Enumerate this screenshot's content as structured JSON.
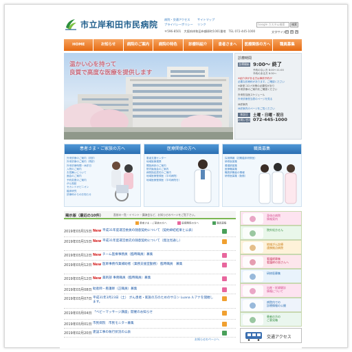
{
  "site": {
    "title": "市立岸和田市民病院"
  },
  "header": {
    "links": [
      "病院・交通アクセス",
      "サイトマップ",
      "プライバシーポリシー",
      "リンク"
    ],
    "address": "〒596-8501　大阪府岸和田市額原町1001番地　TEL 072-445-1000",
    "search_placeholder": "Google カスタム検索",
    "search_button": "検索",
    "fontsize_label": "文字サイズ",
    "fontsize_options": [
      "小",
      "中",
      "大"
    ]
  },
  "nav": [
    "HOME",
    "お知らせ",
    "病院のご案内",
    "病院の特色",
    "診療科紹介",
    "患者さまへ",
    "医療関係の方へ",
    "職員募集"
  ],
  "hero": {
    "slogan_line1": "温かい心を持って",
    "slogan_line2": "良質で高度な医療を提供します"
  },
  "hours": {
    "title": "診療時間",
    "reception_tag": "診療開始",
    "reception_time": "9:00～ 終了",
    "note1": "予約のない方 8:00～11:00",
    "note2": "予約のある方 8:30～",
    "note_red": "※紹介状がある方は事前予約が",
    "note_link": "必要な診療科があります。ご確認ください",
    "note_lines": [
      "※新型コロナ対策の必要性があり",
      "外来診療のご案内をご確認ください"
    ],
    "schedule_title": "外来担当医スケジュール",
    "schedule_link": "外来診療担当表のページを見る",
    "closed_title": "休診案内",
    "closed_link": "休診案内のページをご覧ください",
    "holiday_tag": "休診日",
    "holiday_text": "土曜・日曜・祝日",
    "tel_tag": "お問い合わせ",
    "tel": "072-445-1000",
    "info_button": "休診案内のページをご覧ください"
  },
  "categories": [
    {
      "title": "患者さま・ご家族の方へ",
      "links": [
        "外来診療のご案内（初診）",
        "外来診療のご案内（再診）",
        "外来診療時間・休診日",
        "入院のご案内",
        "お見舞いについて",
        "面会のご案内",
        "予約変更のご案内",
        "がん相談",
        "セカンドオピニオン",
        "臨床研究",
        "診療科からのお知らせ"
      ]
    },
    {
      "title": "医療関係の方へ",
      "links": [
        "患者支援センター",
        "地域医療連携",
        "開放病床のご案内",
        "院内勉強会のご案内",
        "病院指定居宅のご案内",
        "地域医療登録医（平均病院）",
        "地域医療登録医（平均病院を）"
      ]
    },
    {
      "title": "職員募集",
      "links": [
        "採用情報（初期臨床研修医）",
        "研修医募集",
        "看護師募集",
        "医療職募集",
        "職員求職者の情報",
        "研修医募集（勤務）"
      ]
    }
  ],
  "notices": {
    "title": "掲示版",
    "latest": "（最近の10件）",
    "subtitle": "直前の一覧・イベント・講演会など、お知らせのページをご覧下さい。",
    "legend": [
      "患者さま・ご家族の方へ",
      "医療関係の方へ",
      "職員募集"
    ],
    "items": [
      {
        "date": "2019年03月15日",
        "new": "New",
        "title": "平成31年度運営委員の随意契約について（契約締結結果と公表）",
        "tag": "green"
      },
      {
        "date": "2019年03月15日",
        "new": "New",
        "title": "平成31年度運営委託の随意契約について（発注見通し）",
        "tag": "orange"
      },
      {
        "date": "2019年03月12日",
        "new": "New",
        "title": "チーム医療事務員（臨時職員）募集",
        "tag": "pink"
      },
      {
        "date": "2019年03月12日",
        "new": "New",
        "title": "医師事務作業補助者（業務支援室勤務） 臨時職員　募集",
        "tag": "pink"
      },
      {
        "date": "2019年03月12日",
        "new": "New",
        "title": "薬剤部 事務職員（臨時職員）募集",
        "tag": "pink"
      },
      {
        "date": "2019年03月08日",
        "new": "",
        "title": "助産師・看護師（正職員）募集",
        "tag": "pink"
      },
      {
        "date": "2019年03月07日",
        "new": "",
        "title": "平成31年3月23日（土） がん患者・家族の方のためのサロン Luana ルアナを開催します。",
        "tag": "orange"
      },
      {
        "date": "2019年03月04日",
        "new": "",
        "title": "「ベビーマッサージ講座」開催のお知らせ",
        "tag": "orange"
      },
      {
        "date": "2019年03月01日",
        "new": "",
        "title": "市民病院　市民モニター募集",
        "tag": "orange"
      },
      {
        "date": "2019年02月20日",
        "new": "",
        "title": "建設工事の執行状況の公表",
        "tag": "green"
      }
    ],
    "more": "お知らせのページへ"
  },
  "banners": [
    {
      "text": [
        "身体の病院",
        "情報案内"
      ],
      "color": "#fde3f0",
      "text_color": "#d14b8b"
    },
    {
      "text": [
        "院外処方せん"
      ],
      "color": "#e9f7ea",
      "text_color": "#2f8a3c"
    },
    {
      "text": [
        "地域がん診療",
        "連携拠点病院"
      ],
      "color": "#fef2d9",
      "text_color": "#c77a10"
    },
    {
      "text": [
        "看護師募集",
        "看護師の皆さんへ"
      ],
      "color": "#fde6ec",
      "text_color": "#c8365c"
    },
    {
      "text": [
        "研修医募集"
      ],
      "color": "#e9f3fc",
      "text_color": "#2b6fb2"
    },
    {
      "text": [
        "出産・妊婦健診",
        "情報について"
      ],
      "color": "#fde3f0",
      "text_color": "#d14b8b"
    },
    {
      "text": [
        "病院内での",
        "診療情報の公開"
      ],
      "color": "#eef3fb",
      "text_color": "#2b6fb2"
    },
    {
      "text": [
        "患者の方の",
        "ご意見箱"
      ],
      "color": "#eaf6ee",
      "text_color": "#2f8a3c"
    }
  ],
  "access": {
    "label": "交通アクセス"
  }
}
